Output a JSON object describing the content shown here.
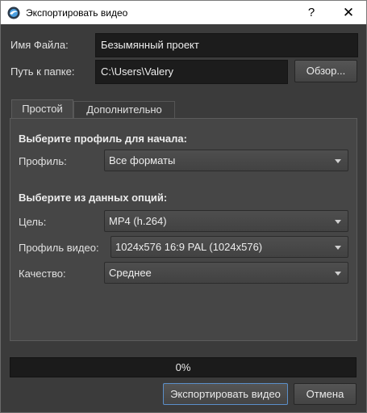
{
  "window": {
    "title": "Экспортировать видео",
    "help_glyph": "?",
    "close_glyph": "✕"
  },
  "file": {
    "name_label": "Имя Файла:",
    "name_value": "Безымянный проект",
    "folder_label": "Путь к папке:",
    "folder_value": "C:\\Users\\Valery",
    "browse_label": "Обзор..."
  },
  "tabs": [
    {
      "label": "Простой",
      "active": true
    },
    {
      "label": "Дополнительно",
      "active": false
    }
  ],
  "simple": {
    "profile_heading": "Выберите профиль для начала:",
    "profile_label": "Профиль:",
    "profile_value": "Все форматы",
    "options_heading": "Выберите из данных опций:",
    "target_label": "Цель:",
    "target_value": "MP4 (h.264)",
    "video_profile_label": "Профиль видео:",
    "video_profile_value": "1024x576 16:9 PAL (1024x576)",
    "quality_label": "Качество:",
    "quality_value": "Среднее"
  },
  "progress": {
    "value": 0,
    "text": "0%"
  },
  "actions": {
    "export_label": "Экспортировать видео",
    "cancel_label": "Отмена"
  },
  "colors": {
    "background": "#3b3b3b",
    "panel": "#464646",
    "field": "#1c1c1c",
    "accent": "#3b7fc4"
  }
}
